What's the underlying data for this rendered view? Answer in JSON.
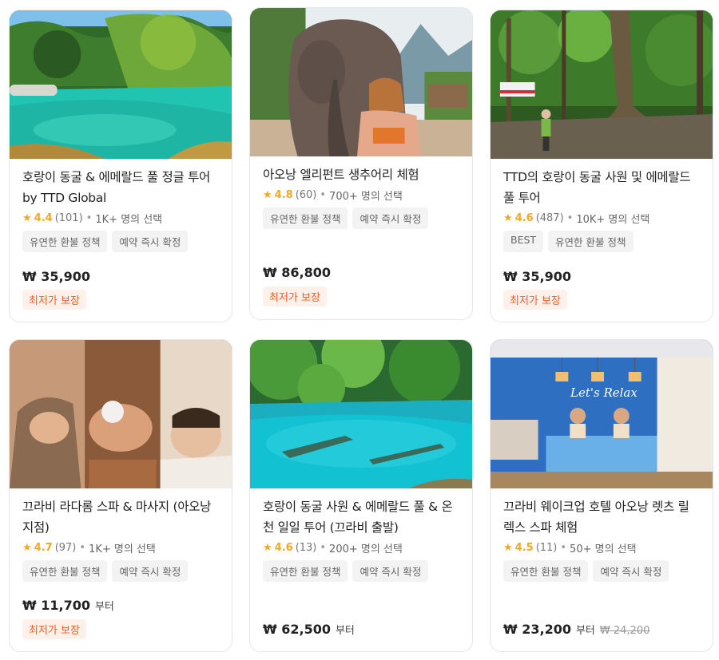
{
  "cards": [
    {
      "title": "호랑이 동굴 & 에메랄드 풀 정글 투어 by TTD Global",
      "score": "4.4",
      "reviews": "(101)",
      "selected": "1K+ 명의 선택",
      "tags": [
        "유연한 환불 정책",
        "예약 즉시 확정"
      ],
      "price": "₩ 35,900",
      "suffix": "",
      "old_price": "",
      "badge": "최저가 보장",
      "image": "emerald-pool-jungle"
    },
    {
      "title": "아오낭 엘리펀트 생추어리 체험",
      "score": "4.8",
      "reviews": "(60)",
      "selected": "700+ 명의 선택",
      "tags": [
        "유연한 환불 정책",
        "예약 즉시 확정"
      ],
      "price": "₩ 86,800",
      "suffix": "",
      "old_price": "",
      "badge": "최저가 보장",
      "image": "elephant-with-woman"
    },
    {
      "title": "TTD의 호랑이 동굴 사원 및 에메랄드 풀 투어",
      "score": "4.6",
      "reviews": "(487)",
      "selected": "10K+ 명의 선택",
      "tags": [
        "BEST",
        "유연한 환불 정책"
      ],
      "price": "₩ 35,900",
      "suffix": "",
      "old_price": "",
      "badge": "최저가 보장",
      "image": "forest-trail"
    },
    {
      "title": "끄라비 라다롬 스파 & 마사지 (아오낭 지점)",
      "score": "4.7",
      "reviews": "(97)",
      "selected": "1K+ 명의 선택",
      "tags": [
        "유연한 환불 정책",
        "예약 즉시 확정"
      ],
      "price": "₩ 11,700",
      "suffix": "부터",
      "old_price": "",
      "badge": "최저가 보장",
      "image": "spa-massage"
    },
    {
      "title": "호랑이 동굴 사원 & 에메랄드 풀 & 온천 일일 투어 (끄라비 출발)",
      "score": "4.6",
      "reviews": "(13)",
      "selected": "200+ 명의 선택",
      "tags": [
        "유연한 환불 정책",
        "예약 즉시 확정"
      ],
      "price": "₩ 62,500",
      "suffix": "부터",
      "old_price": "",
      "badge": "",
      "image": "blue-pool"
    },
    {
      "title": "끄라비 웨이크업 호텔 아오낭 렛츠 릴렉스 스파 체험",
      "score": "4.5",
      "reviews": "(11)",
      "selected": "50+ 명의 선택",
      "tags": [
        "유연한 환불 정책",
        "예약 즉시 확정"
      ],
      "price": "₩ 23,200",
      "suffix": "부터",
      "old_price": "₩ 24,200",
      "badge": "",
      "image": "spa-reception",
      "sign_text": "Let's Relax"
    }
  ],
  "colors": {
    "star": "#f5a623",
    "badge_text": "#ff5a1f",
    "badge_bg": "#fff1ea",
    "tag_bg": "#f3f3f3"
  }
}
